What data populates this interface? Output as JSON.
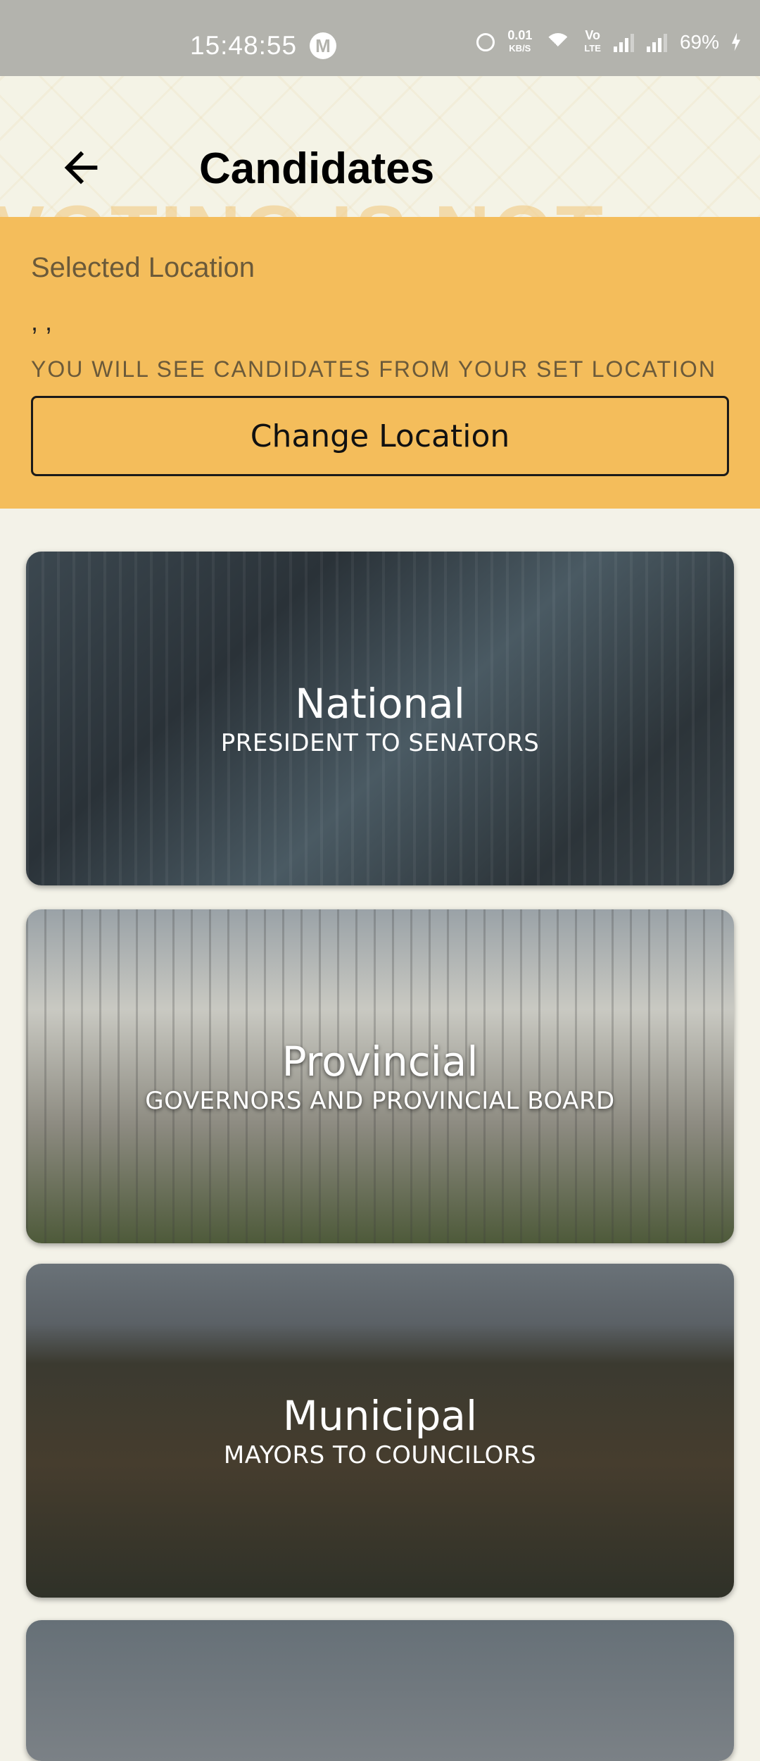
{
  "status_bar": {
    "time": "15:48:55",
    "net_speed_value": "0.01",
    "net_speed_unit": "KB/S",
    "volte_top": "Vo",
    "volte_bottom": "LTE",
    "battery": "69%",
    "icons": [
      "m-app-icon",
      "alarm-icon",
      "wifi-icon",
      "signal-icon",
      "signal-icon",
      "charging-icon"
    ]
  },
  "header": {
    "title": "Candidates",
    "background_text": "VOTING IS NOT"
  },
  "location": {
    "label": "Selected Location",
    "value": ", ,",
    "hint": "YOU WILL SEE CANDIDATES FROM YOUR SET LOCATION",
    "button_label": "Change Location"
  },
  "cards": [
    {
      "title": "National",
      "subtitle": "PRESIDENT TO SENATORS"
    },
    {
      "title": "Provincial",
      "subtitle": "GOVERNORS AND PROVINCIAL BOARD"
    },
    {
      "title": "Municipal",
      "subtitle": "MAYORS TO COUNCILORS"
    }
  ],
  "colors": {
    "accent": "#f4bd5b",
    "background": "#f3f2e8",
    "status_bar": "#b3b3ad"
  }
}
